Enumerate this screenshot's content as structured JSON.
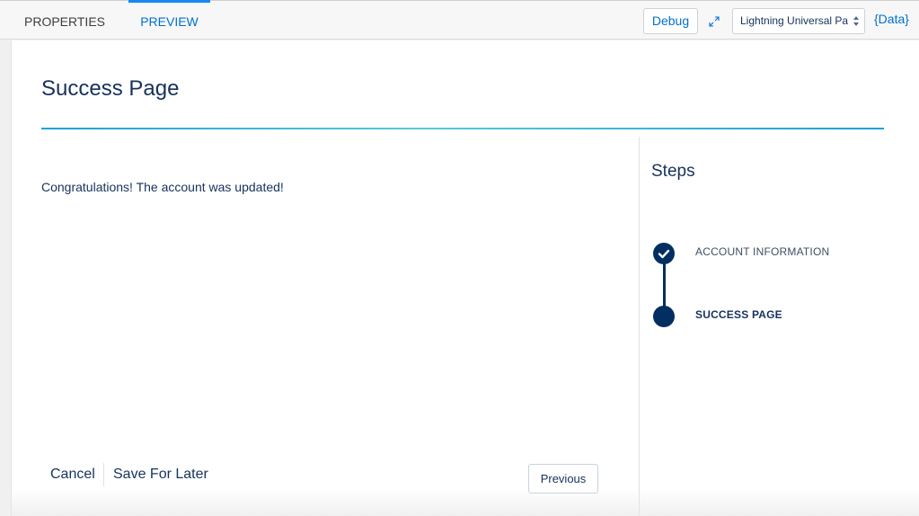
{
  "tabs": [
    {
      "label": "PROPERTIES",
      "active": false
    },
    {
      "label": "PREVIEW",
      "active": true
    }
  ],
  "toolbar": {
    "debug_label": "Debug",
    "expand_icon": "expand-arrows-icon",
    "template_select_value": "Lightning Universal Page",
    "data_link": "{Data}"
  },
  "page": {
    "title": "Success Page",
    "message": "Congratulations! The account was updated!"
  },
  "steps": {
    "title": "Steps",
    "items": [
      {
        "label": "ACCOUNT INFORMATION",
        "status": "completed",
        "icon": "check-icon"
      },
      {
        "label": "SUCCESS PAGE",
        "status": "current",
        "icon": "filled-circle-icon"
      }
    ]
  },
  "footer": {
    "cancel_label": "Cancel",
    "save_later_label": "Save For Later",
    "previous_label": "Previous"
  },
  "colors": {
    "accent": "#0070d2",
    "navy": "#16325c",
    "step_dot": "#032e61",
    "title_rule": "#1ba1d8"
  }
}
